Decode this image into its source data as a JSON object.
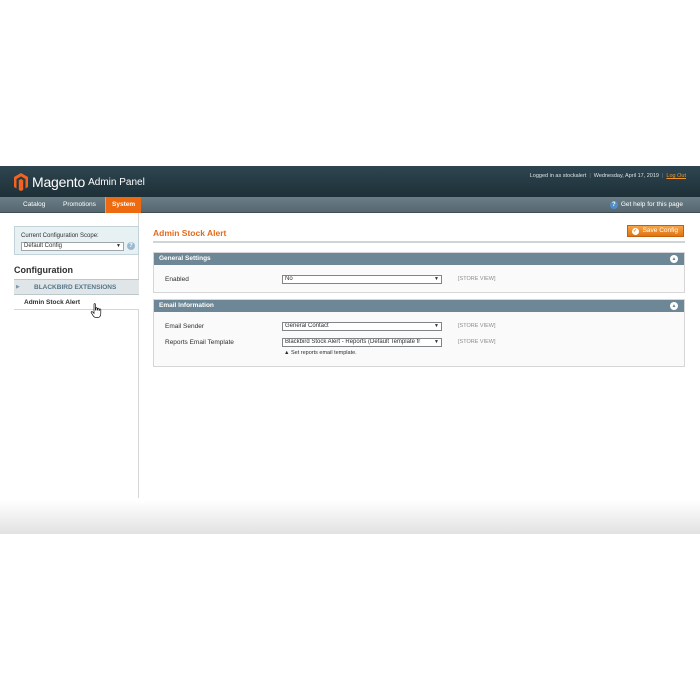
{
  "header": {
    "brand": "Magento",
    "brand_sub": "Admin Panel",
    "logged_in": "Logged in as stockalert",
    "date": "Wednesday, April 17, 2019",
    "logout": "Log Out",
    "logo_icon": "magento-logo-icon"
  },
  "nav": {
    "items": [
      {
        "label": "Catalog"
      },
      {
        "label": "Promotions"
      },
      {
        "label": "System"
      }
    ],
    "active": "System",
    "help": "Get help for this page"
  },
  "sidebar": {
    "scope_label": "Current Configuration Scope:",
    "scope_value": "Default Config",
    "config_title": "Configuration",
    "section": "BLACKBIRD EXTENSIONS",
    "link": "Admin Stock Alert"
  },
  "main": {
    "title": "Admin Stock Alert",
    "save_label": "Save Config",
    "general": {
      "title": "General Settings",
      "rows": [
        {
          "label": "Enabled",
          "value": "No",
          "scope": "[STORE VIEW]"
        }
      ]
    },
    "email": {
      "title": "Email Information",
      "rows": [
        {
          "label": "Email Sender",
          "value": "General Contact",
          "scope": "[STORE VIEW]"
        },
        {
          "label": "Reports Email Template",
          "value": "Blackbird Stock Alert - Reports (Default Template fr",
          "scope": "[STORE VIEW]",
          "note": "Set reports email template."
        }
      ]
    }
  },
  "colors": {
    "accent": "#ed6a11",
    "header": "#2e4550",
    "fieldset_head": "#6e8796"
  }
}
